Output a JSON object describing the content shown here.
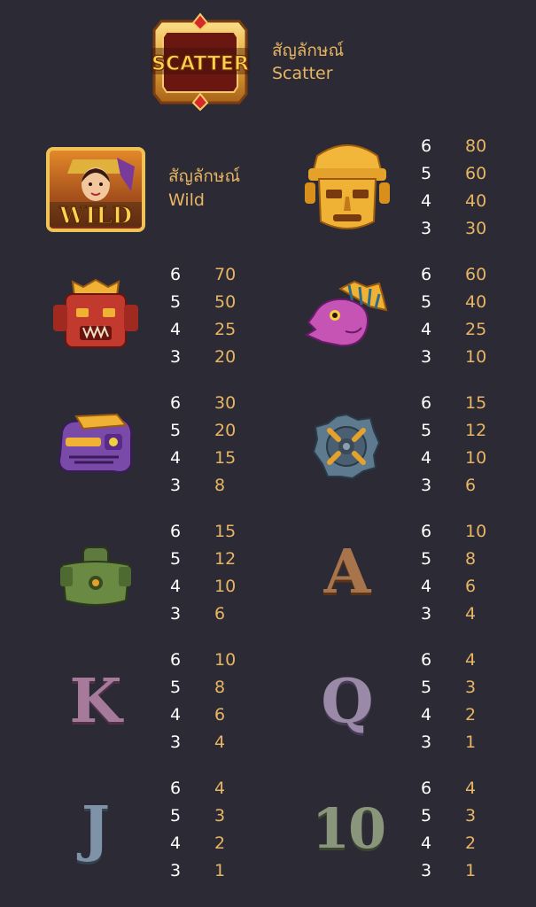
{
  "scatter": {
    "label_th": "สัญลักษณ์",
    "label": "Scatter",
    "icon_text": "SCATTER",
    "icon": "scatter-emblem-icon"
  },
  "wild": {
    "label_th": "สัญลักษณ์",
    "label": "Wild",
    "icon_text": "WILD",
    "icon": "wild-priestess-icon"
  },
  "symbols": [
    {
      "id": "gold-mask",
      "icon": "gold-mask-icon",
      "pays": [
        {
          "count": "6",
          "value": "80"
        },
        {
          "count": "5",
          "value": "60"
        },
        {
          "count": "4",
          "value": "40"
        },
        {
          "count": "3",
          "value": "30"
        }
      ]
    },
    {
      "id": "red-mask",
      "icon": "red-mask-icon",
      "pays": [
        {
          "count": "6",
          "value": "70"
        },
        {
          "count": "5",
          "value": "50"
        },
        {
          "count": "4",
          "value": "25"
        },
        {
          "count": "3",
          "value": "20"
        }
      ]
    },
    {
      "id": "pink-bird",
      "icon": "pink-bird-head-icon",
      "pays": [
        {
          "count": "6",
          "value": "60"
        },
        {
          "count": "5",
          "value": "40"
        },
        {
          "count": "4",
          "value": "25"
        },
        {
          "count": "3",
          "value": "10"
        }
      ]
    },
    {
      "id": "purple-serpent",
      "icon": "purple-serpent-icon",
      "pays": [
        {
          "count": "6",
          "value": "30"
        },
        {
          "count": "5",
          "value": "20"
        },
        {
          "count": "4",
          "value": "15"
        },
        {
          "count": "3",
          "value": "8"
        }
      ]
    },
    {
      "id": "stone-sun",
      "icon": "stone-sun-icon",
      "pays": [
        {
          "count": "6",
          "value": "15"
        },
        {
          "count": "5",
          "value": "12"
        },
        {
          "count": "4",
          "value": "10"
        },
        {
          "count": "3",
          "value": "6"
        }
      ]
    },
    {
      "id": "green-idol",
      "icon": "green-idol-icon",
      "pays": [
        {
          "count": "6",
          "value": "15"
        },
        {
          "count": "5",
          "value": "12"
        },
        {
          "count": "4",
          "value": "10"
        },
        {
          "count": "3",
          "value": "6"
        }
      ]
    },
    {
      "id": "letter-a",
      "icon": "letter-a-icon",
      "letter": "A",
      "color": "#a8744c",
      "pays": [
        {
          "count": "6",
          "value": "10"
        },
        {
          "count": "5",
          "value": "8"
        },
        {
          "count": "4",
          "value": "6"
        },
        {
          "count": "3",
          "value": "4"
        }
      ]
    },
    {
      "id": "letter-k",
      "icon": "letter-k-icon",
      "letter": "K",
      "color": "#a67a9a",
      "pays": [
        {
          "count": "6",
          "value": "10"
        },
        {
          "count": "5",
          "value": "8"
        },
        {
          "count": "4",
          "value": "6"
        },
        {
          "count": "3",
          "value": "4"
        }
      ]
    },
    {
      "id": "letter-q",
      "icon": "letter-q-icon",
      "letter": "Q",
      "color": "#9a8aa8",
      "pays": [
        {
          "count": "6",
          "value": "4"
        },
        {
          "count": "5",
          "value": "3"
        },
        {
          "count": "4",
          "value": "2"
        },
        {
          "count": "3",
          "value": "1"
        }
      ]
    },
    {
      "id": "letter-j",
      "icon": "letter-j-icon",
      "letter": "J",
      "color": "#7f93a8",
      "pays": [
        {
          "count": "6",
          "value": "4"
        },
        {
          "count": "5",
          "value": "3"
        },
        {
          "count": "4",
          "value": "2"
        },
        {
          "count": "3",
          "value": "1"
        }
      ]
    },
    {
      "id": "letter-10",
      "icon": "letter-10-icon",
      "letter": "10",
      "color": "#8a967c",
      "pays": [
        {
          "count": "6",
          "value": "4"
        },
        {
          "count": "5",
          "value": "3"
        },
        {
          "count": "4",
          "value": "2"
        },
        {
          "count": "3",
          "value": "1"
        }
      ]
    }
  ],
  "colors": {
    "background": "#2c2b35",
    "gold_text": "#e7b563",
    "white_text": "#ffffff"
  }
}
